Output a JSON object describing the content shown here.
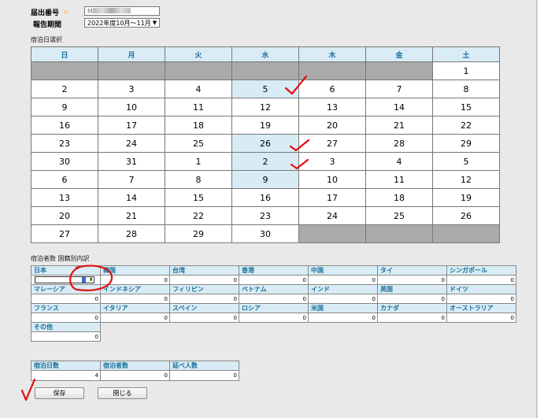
{
  "header": {
    "notification_no_label": "届出番号",
    "notification_no_value": "M",
    "report_period_label": "報告期間",
    "report_period_value": "2022年度10月～11月"
  },
  "calendar": {
    "section_label": "宿泊日選択",
    "weekdays": [
      "日",
      "月",
      "火",
      "水",
      "木",
      "金",
      "土"
    ],
    "rows": [
      [
        "",
        "",
        "",
        "",
        "",
        "",
        "1"
      ],
      [
        "2",
        "3",
        "4",
        "5",
        "6",
        "7",
        "8"
      ],
      [
        "9",
        "10",
        "11",
        "12",
        "13",
        "14",
        "15"
      ],
      [
        "16",
        "17",
        "18",
        "19",
        "20",
        "21",
        "22"
      ],
      [
        "23",
        "24",
        "25",
        "26",
        "27",
        "28",
        "29"
      ],
      [
        "30",
        "31",
        "1",
        "2",
        "3",
        "4",
        "5"
      ],
      [
        "6",
        "7",
        "8",
        "9",
        "10",
        "11",
        "12"
      ],
      [
        "13",
        "14",
        "15",
        "16",
        "17",
        "18",
        "19"
      ],
      [
        "20",
        "21",
        "22",
        "23",
        "24",
        "25",
        "26"
      ],
      [
        "27",
        "28",
        "29",
        "30",
        "",
        "",
        ""
      ]
    ]
  },
  "nationality": {
    "section_label": "宿泊者数 国籍別内訳",
    "rows": [
      [
        {
          "name": "日本",
          "value": "1"
        },
        {
          "name": "韓国",
          "value": "0"
        },
        {
          "name": "台湾",
          "value": "0"
        },
        {
          "name": "香港",
          "value": "0"
        },
        {
          "name": "中国",
          "value": "0"
        },
        {
          "name": "タイ",
          "value": "0"
        },
        {
          "name": "シンガポール",
          "value": "0"
        }
      ],
      [
        {
          "name": "マレーシア",
          "value": "0"
        },
        {
          "name": "インドネシア",
          "value": "0"
        },
        {
          "name": "フィリピン",
          "value": "0"
        },
        {
          "name": "ベトナム",
          "value": "0"
        },
        {
          "name": "インド",
          "value": "0"
        },
        {
          "name": "英国",
          "value": "0"
        },
        {
          "name": "ドイツ",
          "value": "0"
        }
      ],
      [
        {
          "name": "フランス",
          "value": "0"
        },
        {
          "name": "イタリア",
          "value": "0"
        },
        {
          "name": "スペイン",
          "value": "0"
        },
        {
          "name": "ロシア",
          "value": "0"
        },
        {
          "name": "米国",
          "value": "0"
        },
        {
          "name": "カナダ",
          "value": "0"
        },
        {
          "name": "オーストラリア",
          "value": "0"
        }
      ],
      [
        {
          "name": "その他",
          "value": "0"
        }
      ]
    ]
  },
  "totals": [
    {
      "name": "宿泊日数",
      "value": "4"
    },
    {
      "name": "宿泊者数",
      "value": "0"
    },
    {
      "name": "延べ人数",
      "value": "0"
    }
  ],
  "buttons": {
    "save_label": "保存",
    "close_label": "閉じる"
  },
  "colors": {
    "header_bg": "#d9ecf5",
    "header_text": "#1a6f9a",
    "disabled_cell": "#aaaaaa",
    "annotation": "#e01010"
  }
}
